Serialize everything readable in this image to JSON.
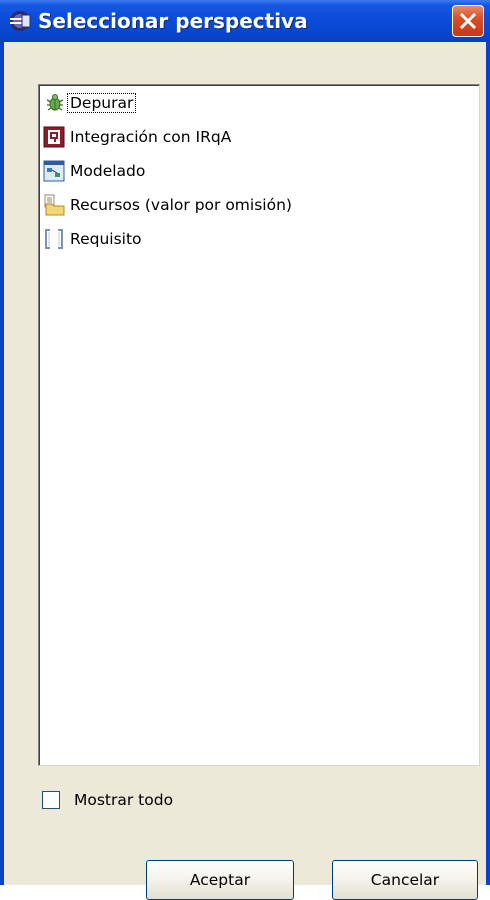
{
  "window": {
    "title": "Seleccionar perspectiva"
  },
  "perspectives": [
    {
      "label": "Depurar",
      "icon": "debug-bug-icon",
      "focused": true
    },
    {
      "label": "Integración con IRqA",
      "icon": "irqa-integration-icon",
      "focused": false
    },
    {
      "label": "Modelado",
      "icon": "modeling-icon",
      "focused": false
    },
    {
      "label": "Recursos (valor por omisión)",
      "icon": "resources-folder-icon",
      "focused": false
    },
    {
      "label": "Requisito",
      "icon": "requirement-brackets-icon",
      "focused": false
    }
  ],
  "show_all": {
    "label": "Mostrar todo",
    "checked": false
  },
  "buttons": {
    "ok_label": "Aceptar",
    "cancel_label": "Cancelar"
  },
  "colors": {
    "titlebar": "#0a4bd8",
    "dialog_background": "#ece9d8",
    "close_button": "#d8502a"
  }
}
